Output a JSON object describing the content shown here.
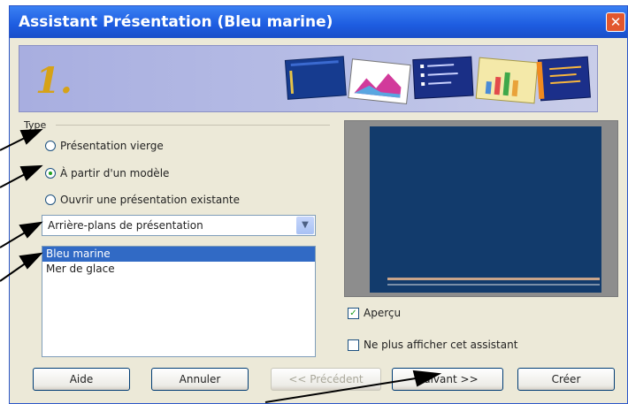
{
  "window": {
    "title": "Assistant Présentation (Bleu marine)",
    "close_glyph": "✕"
  },
  "banner": {
    "step": "1."
  },
  "type_group": {
    "label": "Type",
    "options": [
      {
        "label": "Présentation vierge",
        "selected": false
      },
      {
        "label": "À partir d'un modèle",
        "selected": true
      },
      {
        "label": "Ouvrir une présentation existante",
        "selected": false
      }
    ]
  },
  "category_select": {
    "value": "Arrière-plans de présentation"
  },
  "template_list": {
    "items": [
      "Bleu marine",
      "Mer de glace"
    ],
    "selected_index": 0
  },
  "preview_checkbox": {
    "label": "Aperçu",
    "checked": true
  },
  "no_show_checkbox": {
    "label": "Ne plus afficher cet assistant",
    "checked": false
  },
  "buttons": {
    "help": "Aide",
    "cancel": "Annuler",
    "previous": "<< Précédent",
    "next": "Suivant >>",
    "create": "Créer"
  },
  "colors": {
    "title_bar": "#1d5ce0",
    "selection": "#316ac5",
    "slide_bg": "#123b6c",
    "banner": "#b9bfe6"
  }
}
